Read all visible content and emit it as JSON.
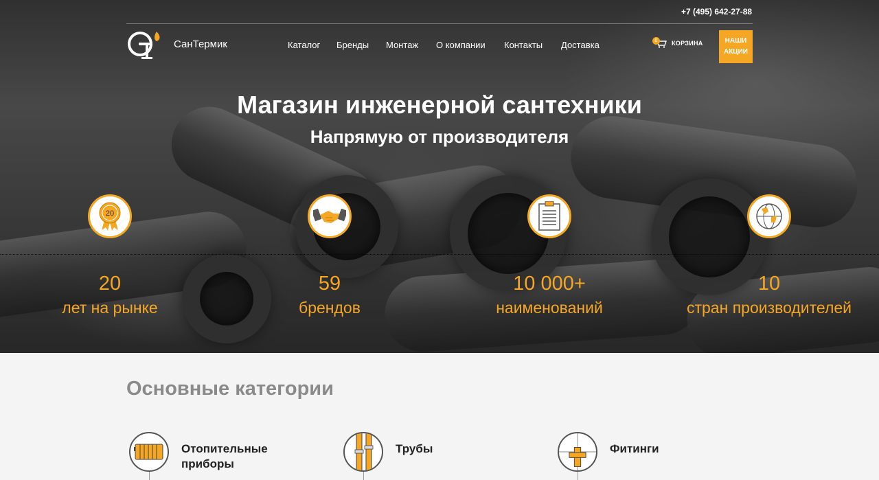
{
  "header": {
    "phone": "+7 (495) 642-27-88",
    "brand_name": "СанТермик",
    "logo_icon": "santermik-logo-icon",
    "nav": [
      "Каталог",
      "Бренды",
      "Монтаж",
      "О компании",
      "Контакты",
      "Доставка"
    ],
    "cart": {
      "label": "КОРЗИНА",
      "count": "0",
      "icon": "cart-icon"
    },
    "promo": {
      "line1": "НАШИ",
      "line2": "АКЦИИ"
    }
  },
  "hero": {
    "title": "Магазин инженерной сантехники",
    "subtitle": "Напрямую от производителя"
  },
  "stats": [
    {
      "icon": "award-badge-icon",
      "badge_text": "20",
      "value": "20",
      "label": "лет на рынке"
    },
    {
      "icon": "handshake-icon",
      "value": "59",
      "label": "брендов"
    },
    {
      "icon": "clipboard-list-icon",
      "value": "10 000+",
      "label": "наименований"
    },
    {
      "icon": "globe-icon",
      "value": "10",
      "label": "стран производителей"
    }
  ],
  "categories": {
    "heading": "Основные категории",
    "items": [
      {
        "icon": "radiator-icon",
        "label_line1": "Отопительные",
        "label_line2": "приборы"
      },
      {
        "icon": "pipes-icon",
        "label_line1": "Трубы",
        "label_line2": ""
      },
      {
        "icon": "fitting-icon",
        "label_line1": "Фитинги",
        "label_line2": ""
      }
    ]
  },
  "colors": {
    "accent": "#f5a623",
    "heading_gray": "#8a8a8a",
    "background": "#f4f4f4"
  }
}
